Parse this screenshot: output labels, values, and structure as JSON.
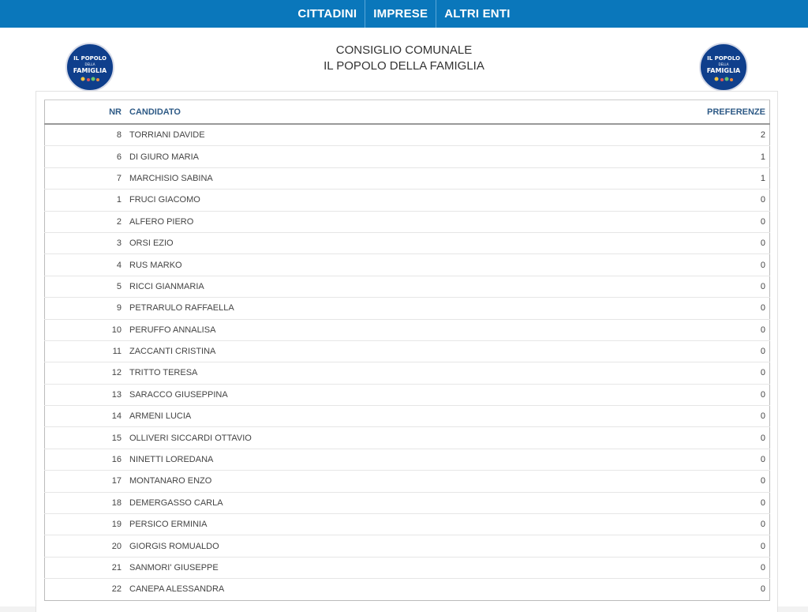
{
  "nav": {
    "items": [
      {
        "label": "CITTADINI"
      },
      {
        "label": "IMPRESE"
      },
      {
        "label": "ALTRI ENTI"
      }
    ]
  },
  "header": {
    "title_line1": "CONSIGLIO COMUNALE",
    "title_line2": "IL POPOLO DELLA FAMIGLIA",
    "logo": {
      "text_top": "IL POPOLO",
      "text_mid": "DELLA",
      "text_bottom": "FAMIGLIA",
      "bg_color": "#0f3f8c"
    }
  },
  "table": {
    "headers": {
      "nr": "NR",
      "candidate": "CANDIDATO",
      "preferences": "PREFERENZE"
    },
    "rows": [
      {
        "nr": "8",
        "name": "TORRIANI DAVIDE",
        "pref": "2"
      },
      {
        "nr": "6",
        "name": "DI GIURO MARIA",
        "pref": "1"
      },
      {
        "nr": "7",
        "name": "MARCHISIO SABINA",
        "pref": "1"
      },
      {
        "nr": "1",
        "name": "FRUCI GIACOMO",
        "pref": "0"
      },
      {
        "nr": "2",
        "name": "ALFERO PIERO",
        "pref": "0"
      },
      {
        "nr": "3",
        "name": "ORSI EZIO",
        "pref": "0"
      },
      {
        "nr": "4",
        "name": "RUS MARKO",
        "pref": "0"
      },
      {
        "nr": "5",
        "name": "RICCI GIANMARIA",
        "pref": "0"
      },
      {
        "nr": "9",
        "name": "PETRARULO RAFFAELLA",
        "pref": "0"
      },
      {
        "nr": "10",
        "name": "PERUFFO ANNALISA",
        "pref": "0"
      },
      {
        "nr": "11",
        "name": "ZACCANTI CRISTINA",
        "pref": "0"
      },
      {
        "nr": "12",
        "name": "TRITTO TERESA",
        "pref": "0"
      },
      {
        "nr": "13",
        "name": "SARACCO GIUSEPPINA",
        "pref": "0"
      },
      {
        "nr": "14",
        "name": "ARMENI LUCIA",
        "pref": "0"
      },
      {
        "nr": "15",
        "name": "OLLIVERI SICCARDI OTTAVIO",
        "pref": "0"
      },
      {
        "nr": "16",
        "name": "NINETTI LOREDANA",
        "pref": "0"
      },
      {
        "nr": "17",
        "name": "MONTANARO ENZO",
        "pref": "0"
      },
      {
        "nr": "18",
        "name": "DEMERGASSO CARLA",
        "pref": "0"
      },
      {
        "nr": "19",
        "name": "PERSICO ERMINIA",
        "pref": "0"
      },
      {
        "nr": "20",
        "name": "GIORGIS ROMUALDO",
        "pref": "0"
      },
      {
        "nr": "21",
        "name": "SANMORI' GIUSEPPE",
        "pref": "0"
      },
      {
        "nr": "22",
        "name": "CANEPA ALESSANDRA",
        "pref": "0"
      }
    ]
  },
  "colors": {
    "topbar": "#0a77bb",
    "header_text": "#2e5a86"
  }
}
